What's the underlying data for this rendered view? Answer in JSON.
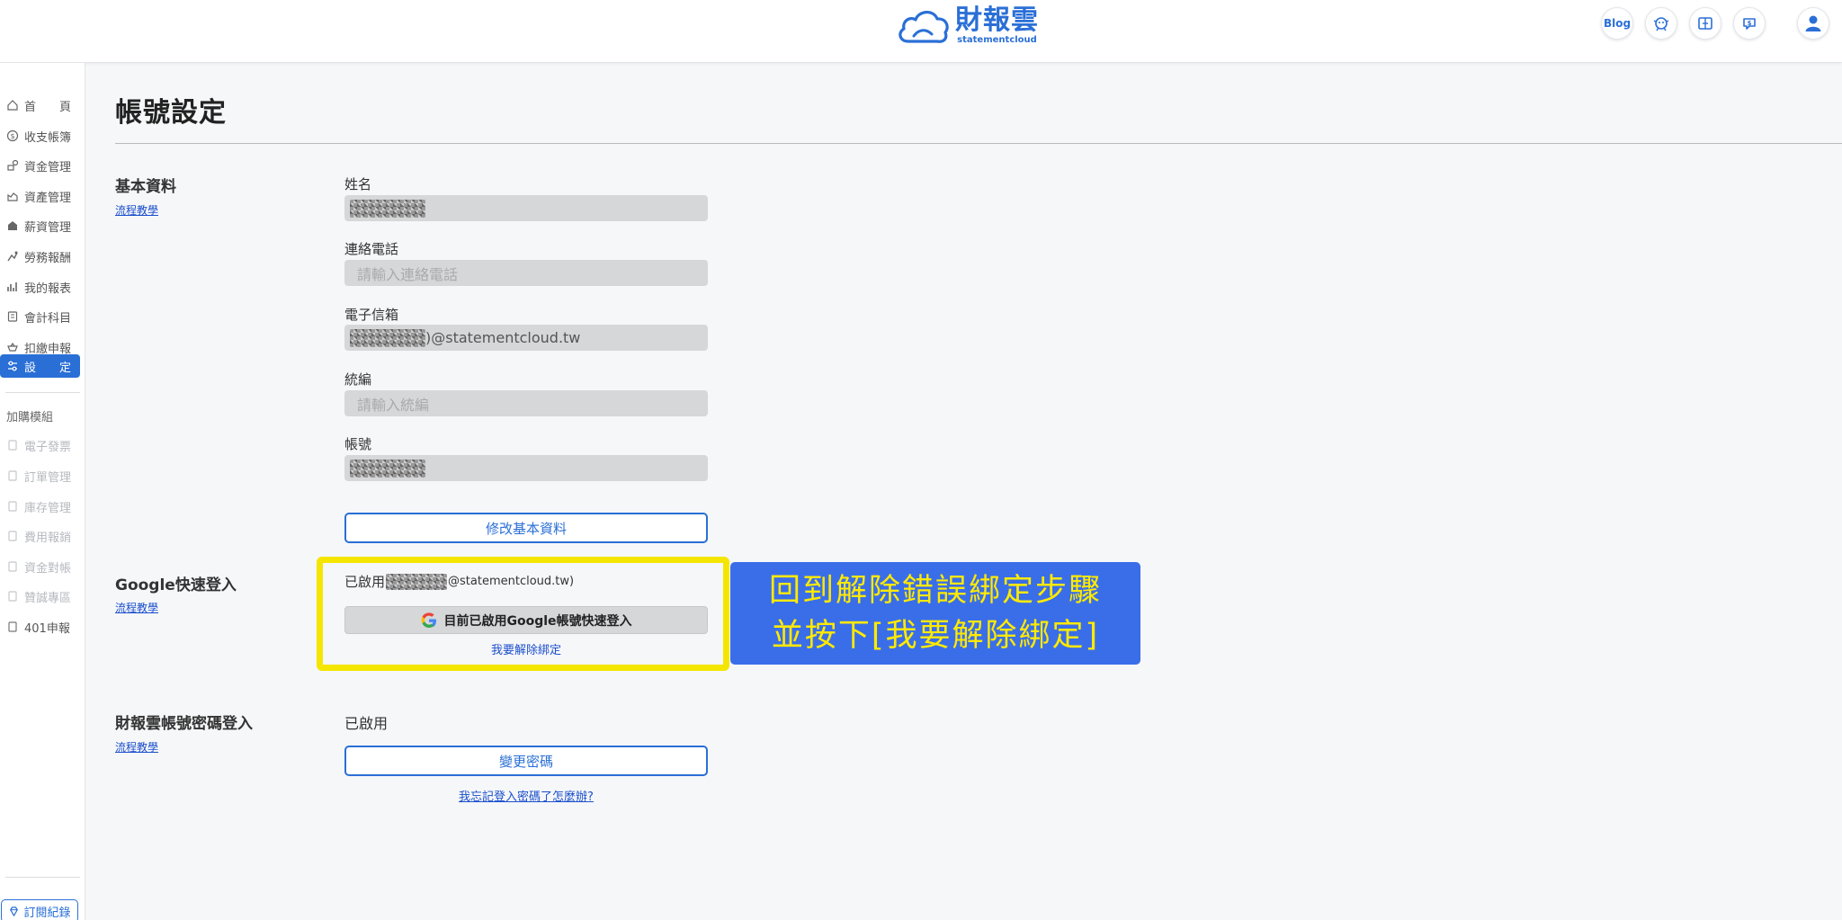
{
  "brand": {
    "name_cn": "財報雲",
    "name_en": "statementcloud",
    "color": "#2a6fd6"
  },
  "header": {
    "blog_label": "Blog",
    "icons": [
      "robot-icon",
      "book-icon",
      "chat-dollar-icon",
      "user-icon"
    ]
  },
  "sidebar": {
    "items": [
      {
        "label": "首　　頁",
        "icon": "home-icon"
      },
      {
        "label": "收支帳簿",
        "icon": "dollar-circle-icon"
      },
      {
        "label": "資金管理",
        "icon": "fund-icon"
      },
      {
        "label": "資產管理",
        "icon": "asset-icon"
      },
      {
        "label": "薪資管理",
        "icon": "salary-icon"
      },
      {
        "label": "勞務報酬",
        "icon": "service-icon"
      },
      {
        "label": "我的報表",
        "icon": "chart-icon"
      },
      {
        "label": "會計科目",
        "icon": "ledger-icon"
      },
      {
        "label": "扣繳申報",
        "icon": "tax-icon"
      },
      {
        "label": "設　　定",
        "icon": "settings-icon",
        "active": true
      }
    ],
    "addon_title": "加購模組",
    "addons": [
      {
        "label": "電子發票",
        "disabled": true
      },
      {
        "label": "訂單管理",
        "disabled": true
      },
      {
        "label": "庫存管理",
        "disabled": true
      },
      {
        "label": "費用報銷",
        "disabled": true
      },
      {
        "label": "資金對帳",
        "disabled": true
      },
      {
        "label": "贊誠專區",
        "disabled": true
      },
      {
        "label": "401申報",
        "disabled": false
      }
    ],
    "subscription_label": "訂閱紀錄"
  },
  "page": {
    "title": "帳號設定",
    "basic": {
      "title": "基本資料",
      "tutorial": "流程教學",
      "fields": {
        "name_label": "姓名",
        "phone_label": "連絡電話",
        "phone_placeholder": "請輸入連絡電話",
        "email_label": "電子信箱",
        "email_suffix": ")@statementcloud.tw",
        "taxid_label": "統編",
        "taxid_placeholder": "請輸入統編",
        "account_label": "帳號"
      },
      "edit_button": "修改基本資料"
    },
    "google": {
      "title": "Google快速登入",
      "tutorial": "流程教學",
      "enabled_prefix": "已啟用",
      "enabled_mail_suffix": "@statementcloud.tw)",
      "button": "目前已啟用Google帳號快速登入",
      "unbind_link": "我要解除綁定"
    },
    "callout": {
      "line1": "回到解除錯誤綁定步驟",
      "line2": "並按下[我要解除綁定]"
    },
    "password": {
      "title": "財報雲帳號密碼登入",
      "tutorial": "流程教學",
      "status": "已啟用",
      "change_button": "變更密碼",
      "forgot_link": "我忘記登入密碼了怎麼辦?"
    }
  }
}
